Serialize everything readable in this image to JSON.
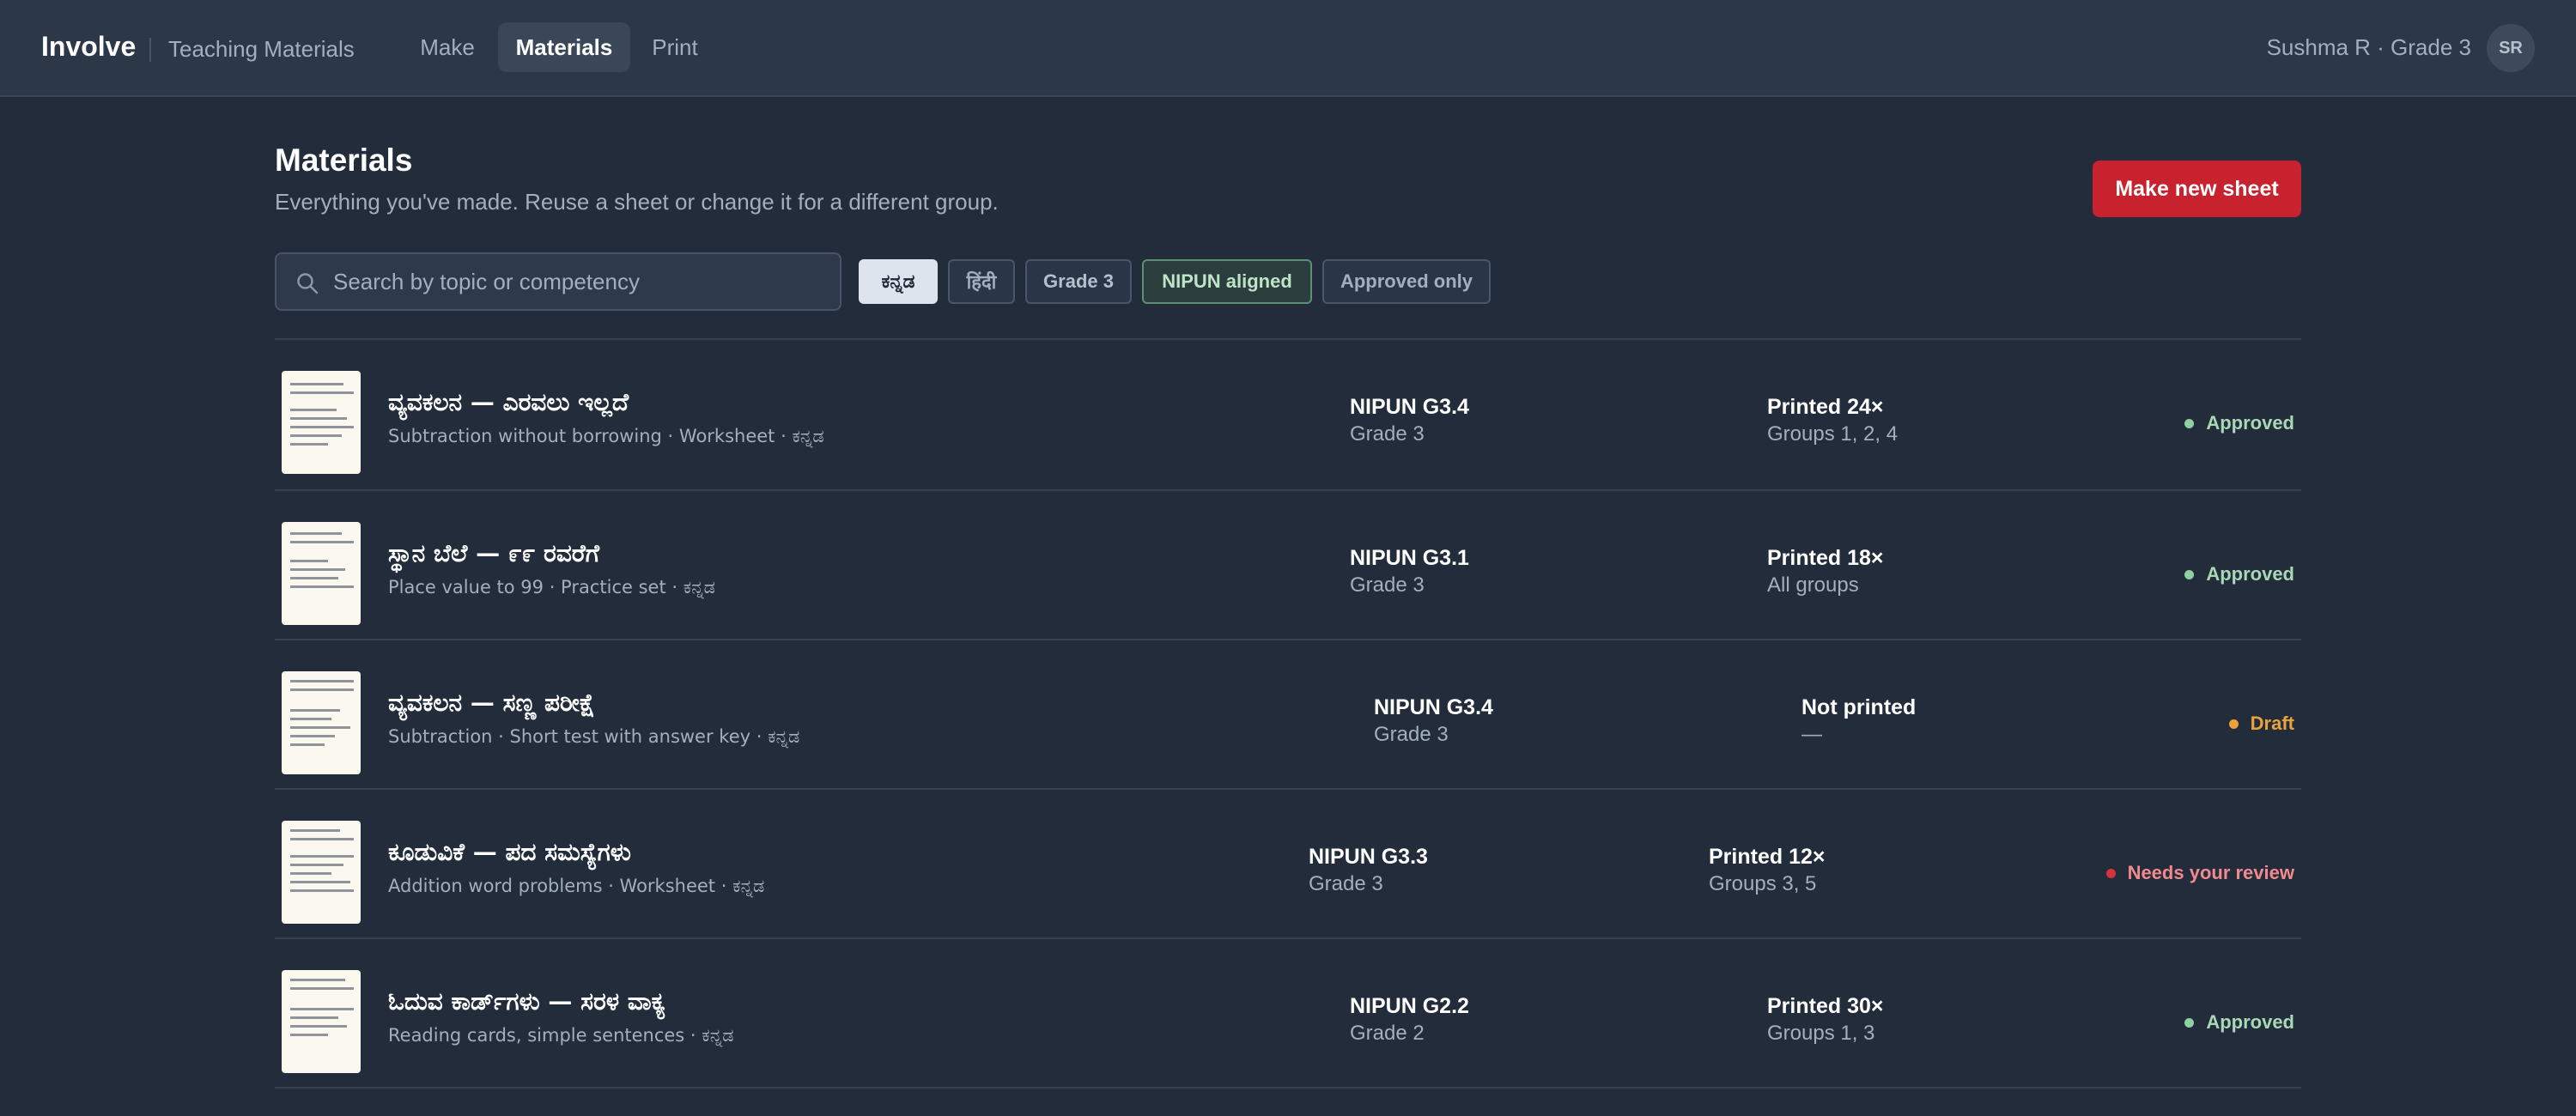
{
  "header": {
    "brand": "Involve",
    "subtitle": "Teaching Materials",
    "tabs": [
      {
        "label": "Make",
        "active": false
      },
      {
        "label": "Materials",
        "active": true
      },
      {
        "label": "Print",
        "active": false
      }
    ],
    "user": "Sushma R · Grade 3",
    "avatar_initials": "SR"
  },
  "page": {
    "title": "Materials",
    "subtitle": "Everything you've made. Reuse a sheet or change it for a different group.",
    "new_button": "Make new sheet"
  },
  "search": {
    "placeholder": "Search by topic or competency",
    "value": ""
  },
  "filters": [
    {
      "label": "ಕನ್ನಡ",
      "selected": true
    },
    {
      "label": "हिंदी",
      "selected": false
    },
    {
      "label": "Grade 3",
      "selected": false
    },
    {
      "label": "NIPUN aligned",
      "selected": false
    },
    {
      "label": "Approved only",
      "selected": false
    }
  ],
  "materials": [
    {
      "title": "ವ್ಯವಕಲನ — ಎರವಲು ಇಲ್ಲದೆ",
      "subtitle": "Subtraction without borrowing · Worksheet · ಕನ್ನಡ",
      "competency": "NIPUN G3.4",
      "grade": "Grade 3",
      "printed": "Printed 24×",
      "groups": "Groups 1, 2, 4",
      "status": "Approved"
    },
    {
      "title": "ಸ್ಥಾನ ಬೆಲೆ — ೯೯ ರವರೆಗೆ",
      "subtitle": "Place value to 99 · Practice set · ಕನ್ನಡ",
      "competency": "NIPUN G3.1",
      "grade": "Grade 3",
      "printed": "Printed 18×",
      "groups": "All groups",
      "status": "Approved"
    },
    {
      "title": "ವ್ಯವಕಲನ — ಸಣ್ಣ ಪರೀಕ್ಷೆ",
      "subtitle": "Subtraction · Short test with answer key · ಕನ್ನಡ",
      "competency": "NIPUN G3.4",
      "grade": "Grade 3",
      "printed": "Not printed",
      "groups": "—",
      "status": "Draft"
    },
    {
      "title": "ಕೂಡುವಿಕೆ — ಪದ ಸಮಸ್ಯೆಗಳು",
      "subtitle": "Addition word problems · Worksheet · ಕನ್ನಡ",
      "competency": "NIPUN G3.3",
      "grade": "Grade 3",
      "printed": "Printed 12×",
      "groups": "Groups 3, 5",
      "status": "Needs your review"
    },
    {
      "title": "ಓದುವ ಕಾರ್ಡ್‌ಗಳು — ಸರಳ ವಾಕ್ಯ",
      "subtitle": "Reading cards, simple sentences · ಕನ್ನಡ",
      "competency": "NIPUN G2.2",
      "grade": "Grade 2",
      "printed": "Printed 30×",
      "groups": "Groups 1, 3",
      "status": "Approved"
    }
  ],
  "colors": {
    "approved": "#a9d8b5",
    "approved_dot": "#8fd0a2",
    "draft": "#e8a33c",
    "review": "#f08a8f",
    "review_dot": "#d8323c",
    "accent": "#c8222e"
  }
}
